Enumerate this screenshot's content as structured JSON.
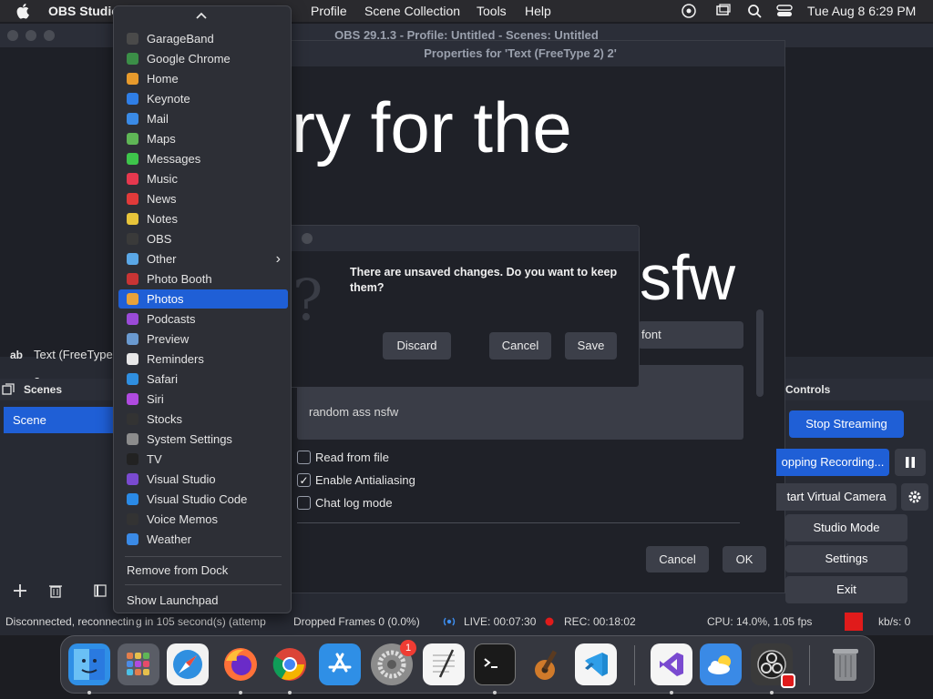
{
  "menubar": {
    "app_name": "OBS Studio",
    "menus": [
      "Profile",
      "Scene Collection",
      "Tools",
      "Help"
    ],
    "clock": "Tue Aug 8  6:29 PM"
  },
  "obs": {
    "title": "OBS 29.1.3 - Profile: Untitled - Scenes: Untitled",
    "source_label": "Text (FreeType 2",
    "scenes_header": "Scenes",
    "scene_name": "Scene",
    "controls_header": "Controls",
    "controls": {
      "stop_streaming": "Stop Streaming",
      "stopping_recording": "opping Recording...",
      "start_virtual_camera": "tart Virtual Camera",
      "studio_mode": "Studio Mode",
      "settings": "Settings",
      "exit": "Exit"
    }
  },
  "properties": {
    "title": "Properties for 'Text (FreeType 2) 2'",
    "preview_text_1": "ry for the",
    "preview_text_2": "sfw",
    "font_field": "font",
    "text_value": "random ass nsfw",
    "checkboxes": [
      {
        "label": "Read from file",
        "checked": false
      },
      {
        "label": "Enable Antialiasing",
        "checked": true
      },
      {
        "label": "Chat log mode",
        "checked": false
      }
    ],
    "cancel": "Cancel",
    "ok": "OK"
  },
  "dialog": {
    "message": "There are unsaved changes. Do you want to keep them?",
    "discard": "Discard",
    "cancel": "Cancel",
    "save": "Save"
  },
  "statusbar": {
    "connection": "Disconnected, reconnectin",
    "connection_tail": "g in 105 second(s) (attemp",
    "dropped": "Dropped Frames 0 (0.0%)",
    "live": "LIVE: 00:07:30",
    "rec": "REC: 00:18:02",
    "cpu": "CPU: 14.0%, 1.05 fps",
    "kbs": "kb/s: 0"
  },
  "dock_menu": {
    "items": [
      {
        "label": "GarageBand",
        "icon": "garageband-icon",
        "color": "#4a4a4a"
      },
      {
        "label": "Google Chrome",
        "icon": "chrome-icon",
        "color": "#3b8e47"
      },
      {
        "label": "Home",
        "icon": "home-icon",
        "color": "#e79a2c"
      },
      {
        "label": "Keynote",
        "icon": "keynote-icon",
        "color": "#2f7ee6"
      },
      {
        "label": "Mail",
        "icon": "mail-icon",
        "color": "#3a8ae6"
      },
      {
        "label": "Maps",
        "icon": "maps-icon",
        "color": "#5fb656"
      },
      {
        "label": "Messages",
        "icon": "messages-icon",
        "color": "#3ec54b"
      },
      {
        "label": "Music",
        "icon": "music-icon",
        "color": "#e6384e"
      },
      {
        "label": "News",
        "icon": "news-icon",
        "color": "#e13a3a"
      },
      {
        "label": "Notes",
        "icon": "notes-icon",
        "color": "#e7c43a"
      },
      {
        "label": "OBS",
        "icon": "obs-icon",
        "color": "#3a3a3a"
      },
      {
        "label": "Other",
        "icon": "folder-icon",
        "color": "#5aa7e6"
      },
      {
        "label": "Photo Booth",
        "icon": "photo-booth-icon",
        "color": "#c83434"
      },
      {
        "label": "Photos",
        "icon": "photos-icon",
        "color": "#e8a23a"
      },
      {
        "label": "Podcasts",
        "icon": "podcasts-icon",
        "color": "#9b4ad8"
      },
      {
        "label": "Preview",
        "icon": "preview-icon",
        "color": "#6a9ad0"
      },
      {
        "label": "Reminders",
        "icon": "reminders-icon",
        "color": "#e8e8e8"
      },
      {
        "label": "Safari",
        "icon": "safari-icon",
        "color": "#2f8fe0"
      },
      {
        "label": "Siri",
        "icon": "siri-icon",
        "color": "#b04ae0"
      },
      {
        "label": "Stocks",
        "icon": "stocks-icon",
        "color": "#333333"
      },
      {
        "label": "System Settings",
        "icon": "system-settings-icon",
        "color": "#8c8c8c"
      },
      {
        "label": "TV",
        "icon": "tv-icon",
        "color": "#222222"
      },
      {
        "label": "Visual Studio",
        "icon": "visual-studio-icon",
        "color": "#7a4ad0"
      },
      {
        "label": "Visual Studio Code",
        "icon": "vscode-icon",
        "color": "#2a8ae6"
      },
      {
        "label": "Voice Memos",
        "icon": "voice-memos-icon",
        "color": "#333333"
      },
      {
        "label": "Weather",
        "icon": "weather-icon",
        "color": "#3a8ae6"
      }
    ],
    "selected": "Photos",
    "remove": "Remove from Dock",
    "launchpad": "Show Launchpad"
  },
  "dock": {
    "apps": [
      "finder-icon",
      "launchpad-icon",
      "safari-icon",
      "firefox-icon",
      "chrome-icon",
      "app-store-icon",
      "system-settings-icon",
      "textedit-icon",
      "terminal-icon",
      "garageband-icon",
      "vscode-icon",
      "visual-studio-icon",
      "weather-icon",
      "obs-icon",
      "trash-icon"
    ],
    "settings_badge": "1"
  },
  "colors": {
    "accent": "#1f5fd6",
    "record_red": "#e01b1b"
  }
}
